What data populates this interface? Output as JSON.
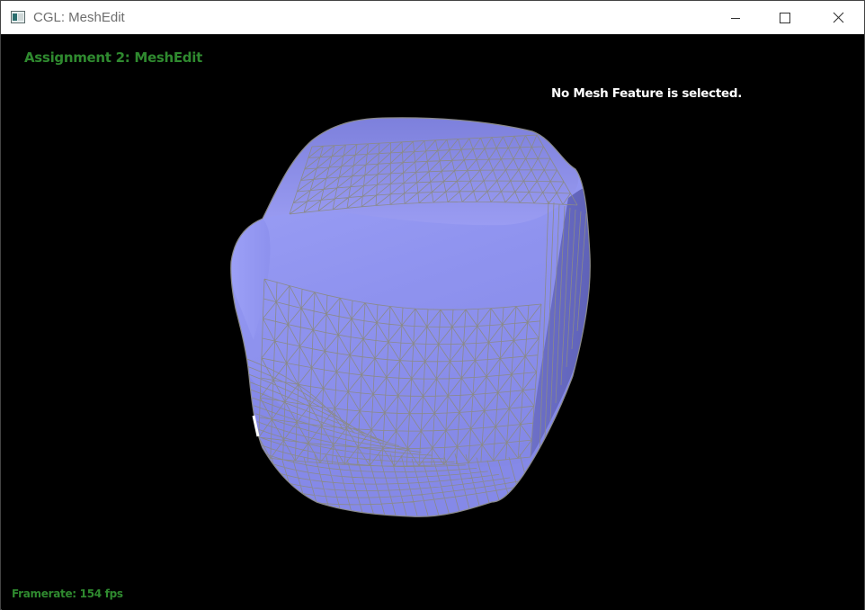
{
  "window": {
    "title": "CGL: MeshEdit"
  },
  "hud": {
    "title": "Assignment 2: MeshEdit",
    "status": "No Mesh Feature is selected.",
    "framerate": "Framerate: 154 fps"
  },
  "colors": {
    "hud_green": "#2f8a2f",
    "mesh_fill": "#8f93f0",
    "wire": "#8a8a8a",
    "background": "#000000"
  },
  "icons": {
    "app": "app-window-icon",
    "minimize": "minimize-icon",
    "maximize": "maximize-icon",
    "close": "close-icon"
  }
}
